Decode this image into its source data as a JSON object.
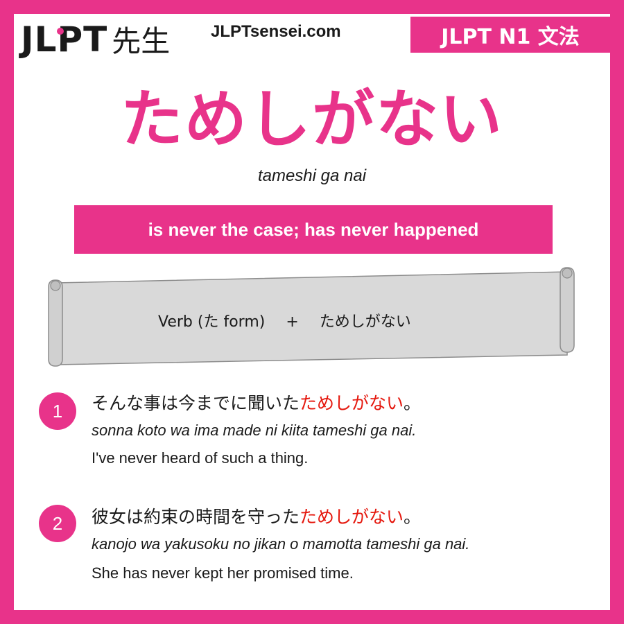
{
  "brand": {
    "logo_text": "JLPT",
    "logo_kanji": "先生",
    "site": "JLPTsensei.com",
    "level_badge": "JLPT N1 文法"
  },
  "grammar": {
    "title": "ためしがない",
    "romaji": "tameshi ga nai",
    "meaning": "is never the case; has never happened"
  },
  "formula": {
    "part1": "Verb (た form)",
    "plus": "+",
    "part2": "ためしがない"
  },
  "examples": [
    {
      "number": "1",
      "jp_before": "そんな事は今までに聞いた",
      "jp_highlight": "ためしがない",
      "jp_after": "。",
      "romaji": "sonna koto wa ima made ni kiita tameshi ga nai.",
      "english": "I've never heard of such a thing."
    },
    {
      "number": "2",
      "jp_before": "彼女は約束の時間を守った",
      "jp_highlight": "ためしがない",
      "jp_after": "。",
      "romaji": "kanojo wa yakusoku no jikan o mamotta tameshi ga nai.",
      "english": "She has never kept her promised time."
    }
  ],
  "colors": {
    "accent": "#e8338a",
    "highlight": "#e5180e",
    "scroll_fill": "#d9d9d9",
    "scroll_stroke": "#8c8c8c"
  }
}
